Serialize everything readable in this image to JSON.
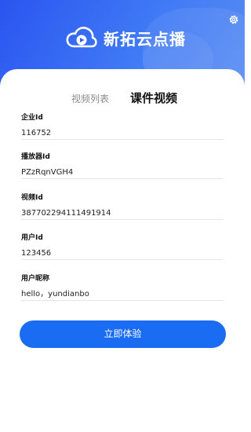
{
  "app": {
    "title": "新拓云点播"
  },
  "icons": {
    "logo": "cloud-play-icon",
    "settings": "gear-icon"
  },
  "colors": {
    "header_start": "#2a55f0",
    "header_end": "#5a8ef4",
    "accent": "#1a6df2"
  },
  "tabs": [
    {
      "label": "视频列表",
      "active": false
    },
    {
      "label": "课件视频",
      "active": true
    }
  ],
  "form": {
    "fields": [
      {
        "label": "企业Id",
        "value": "116752"
      },
      {
        "label": "播放器Id",
        "value": "PZzRqnVGH4"
      },
      {
        "label": "视频Id",
        "value": "387702294111491914"
      },
      {
        "label": "用户Id",
        "value": "123456"
      },
      {
        "label": "用户昵称",
        "value": "hello，yundianbo"
      }
    ]
  },
  "actions": {
    "submit_label": "立即体验"
  }
}
